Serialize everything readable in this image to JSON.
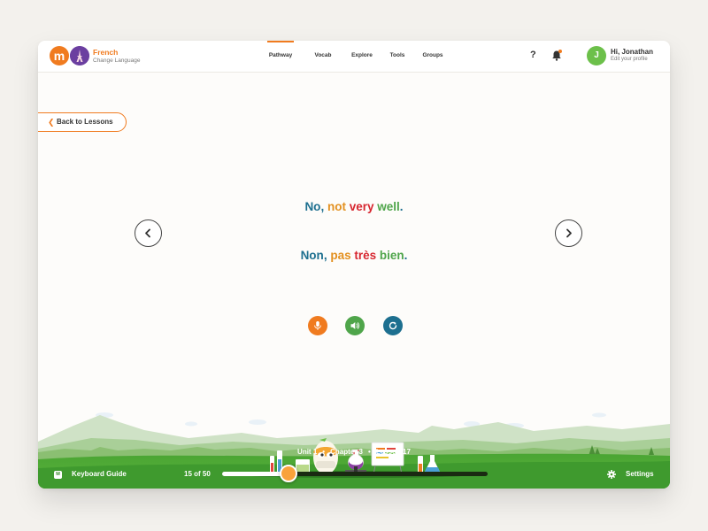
{
  "header": {
    "logo_letter": "m",
    "language": "French",
    "change_language": "Change Language",
    "nav": [
      {
        "label": "Pathway",
        "active": true
      },
      {
        "label": "Vocab",
        "active": false
      },
      {
        "label": "Explore",
        "active": false
      },
      {
        "label": "Tools",
        "active": false
      },
      {
        "label": "Groups",
        "active": false
      }
    ],
    "help_label": "?",
    "avatar_letter": "J",
    "greeting": "Hi, Jonathan",
    "edit_profile": "Edit your profile"
  },
  "back_label": "Back to Lessons",
  "phrase_en": {
    "w1": "No",
    "p1": ",",
    "w2": "not",
    "w3": "very",
    "w4": "well",
    "p2": "."
  },
  "phrase_fr": {
    "w1": "Non",
    "p1": ",",
    "w2": "pas",
    "w3": "très",
    "w4": "bien",
    "p2": "."
  },
  "breadcrumb": {
    "unit": "Unit 1",
    "chapter": "Chapter 3",
    "lesson": "Lesson 17",
    "separator": "•"
  },
  "footer": {
    "keyboard_key": "M",
    "keyboard_label": "Keyboard Guide",
    "progress_label": "15 of 50",
    "progress_fraction": 0.25,
    "settings_label": "Settings"
  },
  "colors": {
    "accent": "#f07b1f",
    "mic": "#f07b1f",
    "speaker": "#4fa54a",
    "replay": "#1d6f8f",
    "grass": "#3f9a2e"
  },
  "icons": {
    "mic": "microphone-icon",
    "speaker": "speaker-icon",
    "replay": "replay-icon",
    "prev": "chevron-left-icon",
    "next": "chevron-right-icon",
    "settings": "gear-icon",
    "bell": "bell-icon"
  }
}
